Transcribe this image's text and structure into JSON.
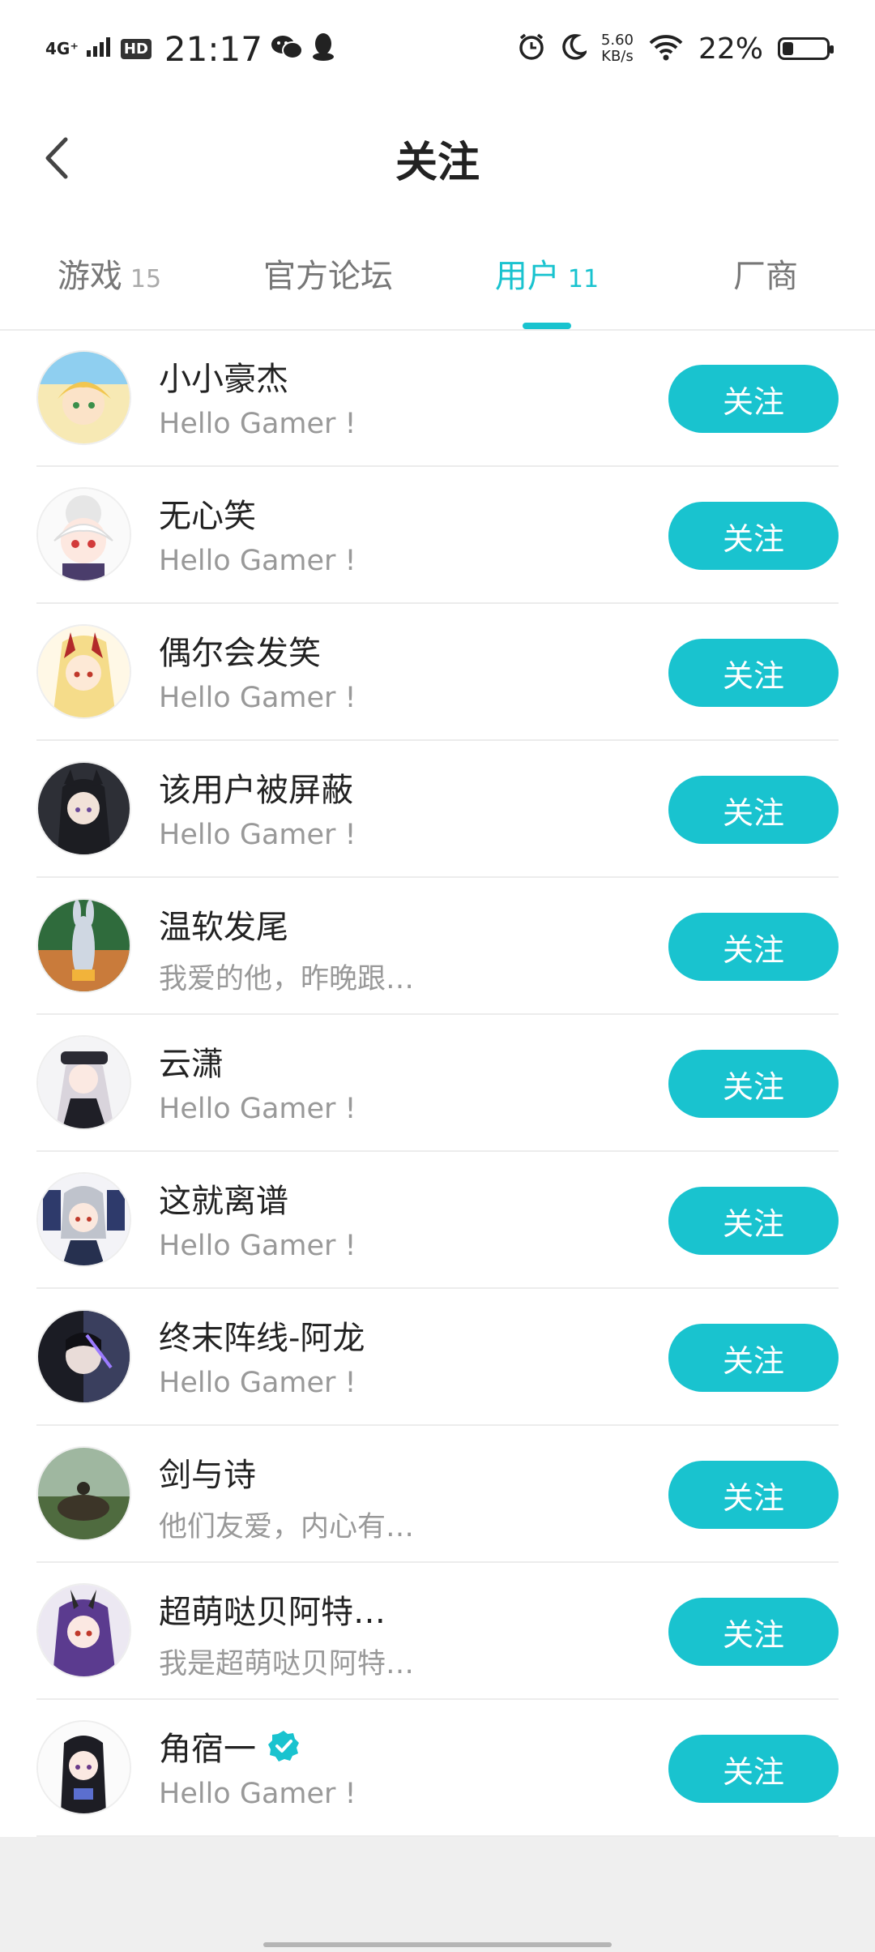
{
  "status_bar": {
    "network": "4G⁺",
    "hd": "HD",
    "time": "21:17",
    "speed_value": "5.60",
    "speed_unit": "KB/s",
    "battery": "22%",
    "battery_level": 0.22
  },
  "header": {
    "title": "关注"
  },
  "tabs": [
    {
      "label": "游戏",
      "count": "15"
    },
    {
      "label": "官方论坛",
      "count": ""
    },
    {
      "label": "用户",
      "count": "11"
    },
    {
      "label": "厂商",
      "count": ""
    }
  ],
  "active_tab": 2,
  "follow_label": "关注",
  "users": [
    {
      "name": "小小豪杰",
      "bio": "Hello Gamer !"
    },
    {
      "name": "无心笑",
      "bio": "Hello Gamer !"
    },
    {
      "name": "偶尔会发笑",
      "bio": "Hello Gamer !"
    },
    {
      "name": "该用户被屏蔽",
      "bio": "Hello Gamer !"
    },
    {
      "name": "温软发尾",
      "bio": "我爱的他，昨晚跟…"
    },
    {
      "name": "云潇",
      "bio": "Hello Gamer !"
    },
    {
      "name": "这就离谱",
      "bio": "Hello Gamer !"
    },
    {
      "name": "终末阵线-阿龙",
      "bio": "Hello Gamer !"
    },
    {
      "name": "剑与诗",
      "bio": "他们友爱，内心有…"
    },
    {
      "name": "超萌哒贝阿特…",
      "bio": "我是超萌哒贝阿特…"
    },
    {
      "name": "角宿一",
      "bio": "Hello Gamer !",
      "verified": true
    }
  ],
  "colors": {
    "accent": "#19c3cf"
  }
}
